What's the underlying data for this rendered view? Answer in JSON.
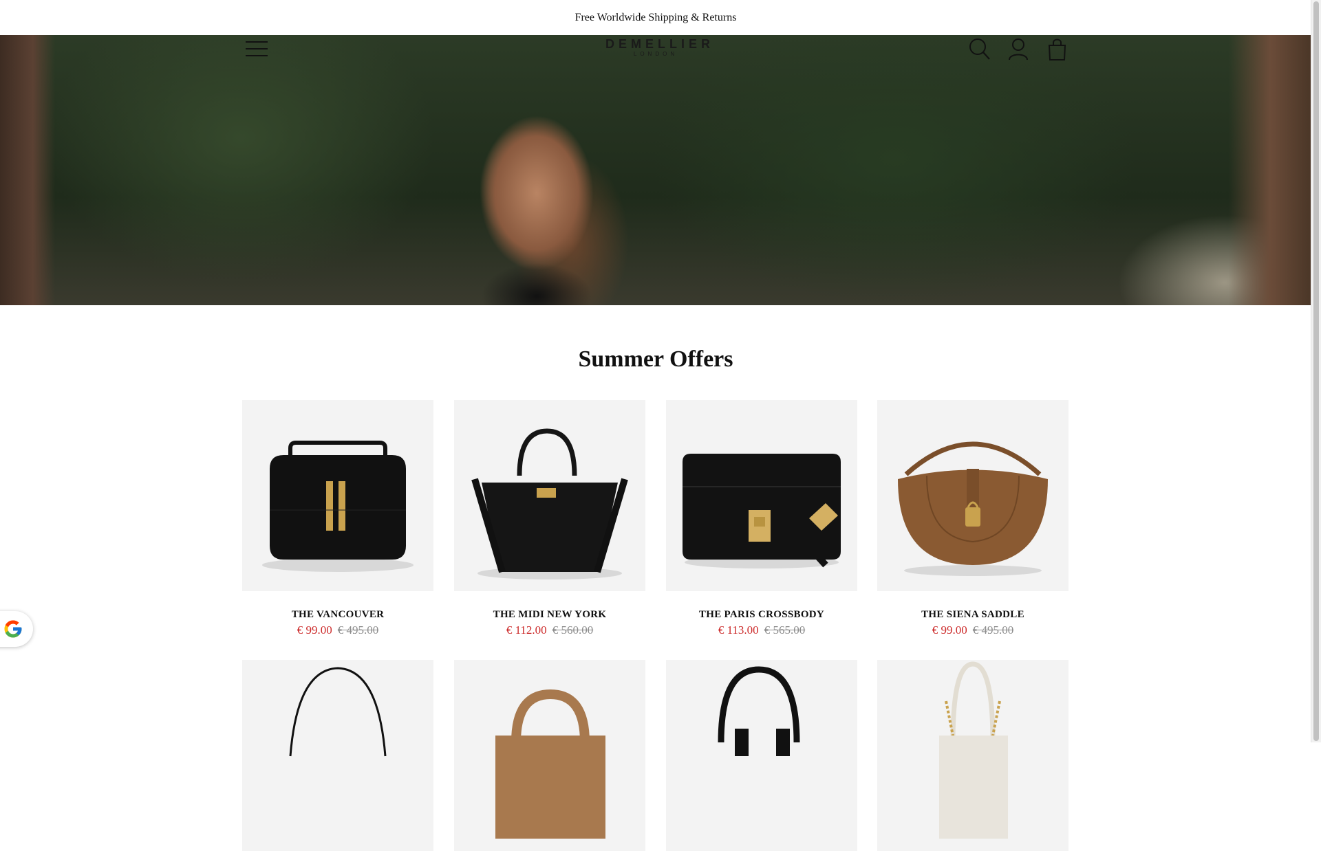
{
  "announcement": {
    "text": "Free Worldwide Shipping & Returns"
  },
  "header": {
    "logo_main": "DEMELLIER",
    "logo_sub": "LONDON",
    "icons": [
      "menu-icon",
      "search-icon",
      "account-icon",
      "bag-icon"
    ]
  },
  "section": {
    "title": "Summer Offers"
  },
  "products": [
    {
      "name": "THE VANCOUVER",
      "price": "€ 99.00",
      "old_price": "€ 495.00",
      "bag_color": "#111111",
      "hardware_color": "#c9a24e"
    },
    {
      "name": "THE MIDI NEW YORK",
      "price": "€ 112.00",
      "old_price": "€ 560.00",
      "bag_color": "#151515",
      "hardware_color": "#c9a24e"
    },
    {
      "name": "THE PARIS CROSSBODY",
      "price": "€ 113.00",
      "old_price": "€ 565.00",
      "bag_color": "#121212",
      "hardware_color": "#d4b062"
    },
    {
      "name": "THE SIENA SADDLE",
      "price": "€ 99.00",
      "old_price": "€ 495.00",
      "bag_color": "#8a5a32",
      "hardware_color": "#c9a24e"
    },
    {
      "name": "",
      "price": "",
      "old_price": "",
      "bag_color": "#111111",
      "hardware_color": "#c9a24e"
    },
    {
      "name": "",
      "price": "",
      "old_price": "",
      "bag_color": "#a8794e",
      "hardware_color": "#c9a24e"
    },
    {
      "name": "",
      "price": "",
      "old_price": "",
      "bag_color": "#111111",
      "hardware_color": "#c9a24e"
    },
    {
      "name": "",
      "price": "",
      "old_price": "",
      "bag_color": "#e8e4dc",
      "hardware_color": "#c9a24e"
    }
  ],
  "colors": {
    "sale": "#cc2a2a",
    "old_price": "#8c8c8c",
    "tile_background": "#f3f3f3"
  },
  "widgets": {
    "google_badge_icon": "google-g-icon"
  }
}
